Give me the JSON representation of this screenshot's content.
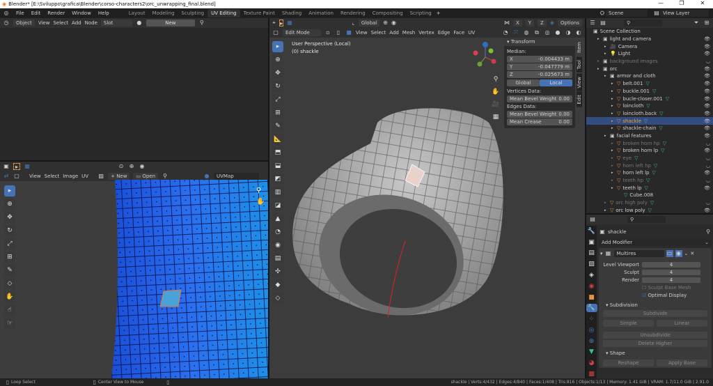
{
  "window": {
    "title": "Blender* [E:\\Sviluppo\\grafica\\Blender\\corso-characters2\\orc_unwrapping_final.blend]",
    "minimize": "—",
    "restore": "❐",
    "close": "✕"
  },
  "menu": [
    "File",
    "Edit",
    "Render",
    "Window",
    "Help"
  ],
  "workspaces": [
    {
      "label": "Layout"
    },
    {
      "label": "Modeling"
    },
    {
      "label": "Sculpting"
    },
    {
      "label": "UV Editing",
      "active": true
    },
    {
      "label": "Texture Paint"
    },
    {
      "label": "Shading"
    },
    {
      "label": "Animation"
    },
    {
      "label": "Rendering"
    },
    {
      "label": "Compositing"
    },
    {
      "label": "Scripting"
    }
  ],
  "scene": {
    "name": "Scene",
    "view_layer": "View Layer"
  },
  "image_editor_top": {
    "mode": "Object",
    "menus": [
      "View",
      "Select",
      "Add",
      "Node"
    ],
    "slot": "Slot",
    "new_label": "New"
  },
  "viewport_header": {
    "orientation": "Global",
    "options": "Options",
    "axes": [
      "X",
      "Y",
      "Z"
    ],
    "mode": "Edit Mode",
    "menus": [
      "View",
      "Select",
      "Add",
      "Mesh",
      "Vertex",
      "Edge",
      "Face",
      "UV"
    ]
  },
  "viewport": {
    "line1": "User Perspective (Local)",
    "line2": "(0) shackle"
  },
  "npanel": {
    "tabs": [
      "Item",
      "Tool",
      "View",
      "Edit"
    ],
    "title": "Transform",
    "median_label": "Median:",
    "coords": [
      {
        "axis": "X",
        "value": "-0.004433 m"
      },
      {
        "axis": "Y",
        "value": "-0.047779 m"
      },
      {
        "axis": "Z",
        "value": "-0.025673 m"
      }
    ],
    "global": "Global",
    "local": "Local",
    "vertices_data": "Vertices Data:",
    "mean_bevel_weight": "Mean Bevel Weight",
    "v_bevel": "0.00",
    "edges_data": "Edges Data:",
    "e_bevel": "0.00",
    "mean_crease": "Mean Crease",
    "e_crease": "0.00"
  },
  "uv_editor": {
    "menus": [
      "View",
      "Select",
      "Image",
      "UV"
    ],
    "new_label": "New",
    "open_label": "Open",
    "uvmap": "UVMap"
  },
  "outliner": {
    "root": "Scene Collection",
    "items": [
      {
        "label": "light and camera",
        "depth": 1,
        "type": "collection"
      },
      {
        "label": "Camera",
        "depth": 2,
        "type": "camera"
      },
      {
        "label": "Light",
        "depth": 2,
        "type": "light"
      },
      {
        "label": "background images",
        "depth": 1,
        "type": "collection",
        "dim": true
      },
      {
        "label": "orc",
        "depth": 1,
        "type": "collection"
      },
      {
        "label": "armor and cloth",
        "depth": 2,
        "type": "collection"
      },
      {
        "label": "belt.001",
        "depth": 3,
        "type": "mesh"
      },
      {
        "label": "buckle.001",
        "depth": 3,
        "type": "mesh"
      },
      {
        "label": "bucle-closer.001",
        "depth": 3,
        "type": "mesh"
      },
      {
        "label": "loincloth",
        "depth": 3,
        "type": "mesh"
      },
      {
        "label": "loincloth.back",
        "depth": 3,
        "type": "mesh"
      },
      {
        "label": "shackle",
        "depth": 3,
        "type": "mesh",
        "selected": true
      },
      {
        "label": "shackle-chain",
        "depth": 3,
        "type": "mesh"
      },
      {
        "label": "facial features",
        "depth": 2,
        "type": "collection"
      },
      {
        "label": "broken horn hp",
        "depth": 3,
        "type": "mesh",
        "dim": true
      },
      {
        "label": "broken horn lp",
        "depth": 3,
        "type": "mesh"
      },
      {
        "label": "eye",
        "depth": 3,
        "type": "mesh",
        "dim": true
      },
      {
        "label": "horn left hp",
        "depth": 3,
        "type": "mesh",
        "dim": true
      },
      {
        "label": "horn left lp",
        "depth": 3,
        "type": "mesh"
      },
      {
        "label": "teeth hp",
        "depth": 3,
        "type": "mesh",
        "dim": true
      },
      {
        "label": "teeth lp",
        "depth": 3,
        "type": "mesh"
      },
      {
        "label": "Cube.008",
        "depth": 4,
        "type": "meshdata"
      },
      {
        "label": "orc high poly",
        "depth": 2,
        "type": "mesh",
        "dim": true
      },
      {
        "label": "orc low poly",
        "depth": 2,
        "type": "mesh"
      }
    ]
  },
  "properties": {
    "object": "shackle",
    "add_modifier": "Add Modifier",
    "modifier": "Multires",
    "fields": [
      {
        "label": "Level Viewport",
        "value": "4"
      },
      {
        "label": "Sculpt",
        "value": "4"
      },
      {
        "label": "Render",
        "value": "4"
      }
    ],
    "sculpt_base_mesh": "Sculpt Base Mesh",
    "optimal_display": "Optimal Display",
    "subdivision": "Subdivision",
    "subdivide": "Subdivide",
    "simple": "Simple",
    "linear": "Linear",
    "unsubdivide": "Unsubdivide",
    "delete_higher": "Delete Higher",
    "shape": "Shape",
    "reshape": "Reshape",
    "apply_base": "Apply Base"
  },
  "status": {
    "left": "Loop Select",
    "middle": "Center View to Mouse",
    "stats": "shackle | Verts:4/432 | Edges:4/840 | Faces:1/408 | Tris:816 | Objects:1/13 | Memory: 1.41 GiB | VRAM: 1.7/11.0 GiB | 2.91.0"
  },
  "colors": {
    "accent": "#4772b3",
    "selected_orange": "#f0a030",
    "uv_blue": "#1f5de0"
  }
}
